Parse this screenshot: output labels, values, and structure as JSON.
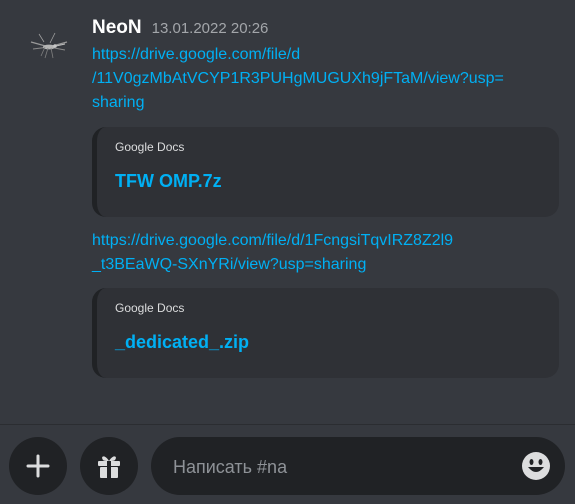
{
  "message": {
    "author": "NeoN",
    "timestamp": "13.01.2022 20:26",
    "avatar_icon": "mosquito-icon",
    "link1_lines": [
      "https://drive.google.com/file/d",
      "/11V0gzMbAtVCYP1R3PUHgMUGUXh9jFTaM/view?usp=",
      "sharing"
    ],
    "embed1": {
      "provider": "Google Docs",
      "title": "TFW OMP.7z"
    },
    "link2_lines": [
      "https://drive.google.com/file/d/1FcngsiTqvIRZ8Z2l9",
      "_t3BEaWQ-SXnYRi/view?usp=sharing"
    ],
    "embed2": {
      "provider": "Google Docs",
      "title": "_dedicated_.zip"
    }
  },
  "composer": {
    "placeholder": "Написать #na",
    "plus_icon": "plus-icon",
    "gift_icon": "gift-icon",
    "emoji_icon": "emoji-icon"
  },
  "colors": {
    "background": "#36393f",
    "embed_bg": "#2f3136",
    "link": "#00b0f4",
    "control_bg": "#202225"
  }
}
